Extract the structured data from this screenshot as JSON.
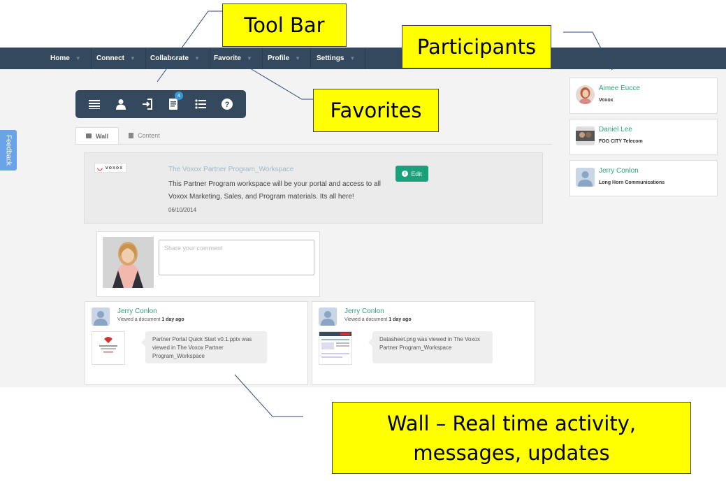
{
  "nav": {
    "items": [
      {
        "label": "Home"
      },
      {
        "label": "Connect"
      },
      {
        "label": "Collaborate"
      },
      {
        "label": "Favorite"
      },
      {
        "label": "Profile"
      },
      {
        "label": "Settings"
      }
    ]
  },
  "feedback_label": "Feedback",
  "toolbar": {
    "icons": [
      "list-icon",
      "person-icon",
      "sign-in-icon",
      "document-icon",
      "bulleted-list-icon",
      "help-icon"
    ],
    "document_badge": "4"
  },
  "tabs": {
    "wall": "Wall",
    "content": "Content"
  },
  "workspace": {
    "logo_text": "voxox",
    "title": "The Voxox Partner Program_Workspace",
    "description": "This Partner Program workspace will be your portal and access to all Voxox Marketing, Sales, and Program materials. Its all here!",
    "date": "06/10/2014",
    "edit_label": "Edit"
  },
  "comment": {
    "placeholder": "Share your comment"
  },
  "activities": [
    {
      "name": "Jerry Conlon",
      "action": "Viewed a document",
      "time": "1 day ago",
      "message": "Partner Portal Quick Start v0.1.pptx was viewed in The Voxox Partner Program_Workspace"
    },
    {
      "name": "Jerry Conlon",
      "action": "Viewed a document",
      "time": "1 day ago",
      "message": "Datasheet.png was viewed in The Voxox Partner Program_Workspace"
    }
  ],
  "participants": [
    {
      "name": "Aimee Eucce",
      "org": "Voxox"
    },
    {
      "name": "Daniel Lee",
      "org": "FOG CITY Telecom"
    },
    {
      "name": "Jerry Conlon",
      "org": "Long Horn Communications"
    }
  ],
  "callouts": {
    "toolbar": "Tool Bar",
    "participants": "Participants",
    "favorites": "Favorites",
    "wall_line1": "Wall – Real time activity,",
    "wall_line2": "messages, updates"
  },
  "colors": {
    "navbar": "#34495e",
    "accent_green": "#1aa07a",
    "name_green": "#2ea37a",
    "callout_yellow": "#ffff00",
    "feedback_blue": "#6aa3e8"
  }
}
